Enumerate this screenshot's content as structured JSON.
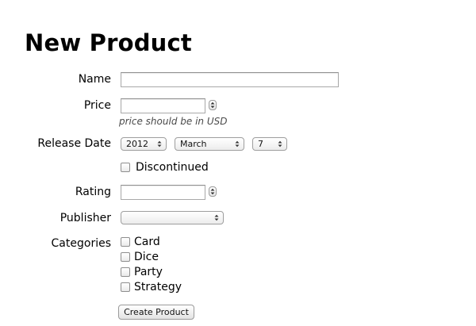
{
  "page": {
    "title": "New Product"
  },
  "form": {
    "name": {
      "label": "Name",
      "value": ""
    },
    "price": {
      "label": "Price",
      "value": "",
      "hint": "price should be in USD"
    },
    "release_date": {
      "label": "Release Date",
      "year": "2012",
      "month": "March",
      "day": "7"
    },
    "discontinued": {
      "label": "Discontinued",
      "checked": false
    },
    "rating": {
      "label": "Rating",
      "value": ""
    },
    "publisher": {
      "label": "Publisher",
      "value": ""
    },
    "categories": {
      "label": "Categories",
      "options": [
        {
          "label": "Card",
          "checked": false
        },
        {
          "label": "Dice",
          "checked": false
        },
        {
          "label": "Party",
          "checked": false
        },
        {
          "label": "Strategy",
          "checked": false
        }
      ]
    },
    "submit_label": "Create Product"
  }
}
